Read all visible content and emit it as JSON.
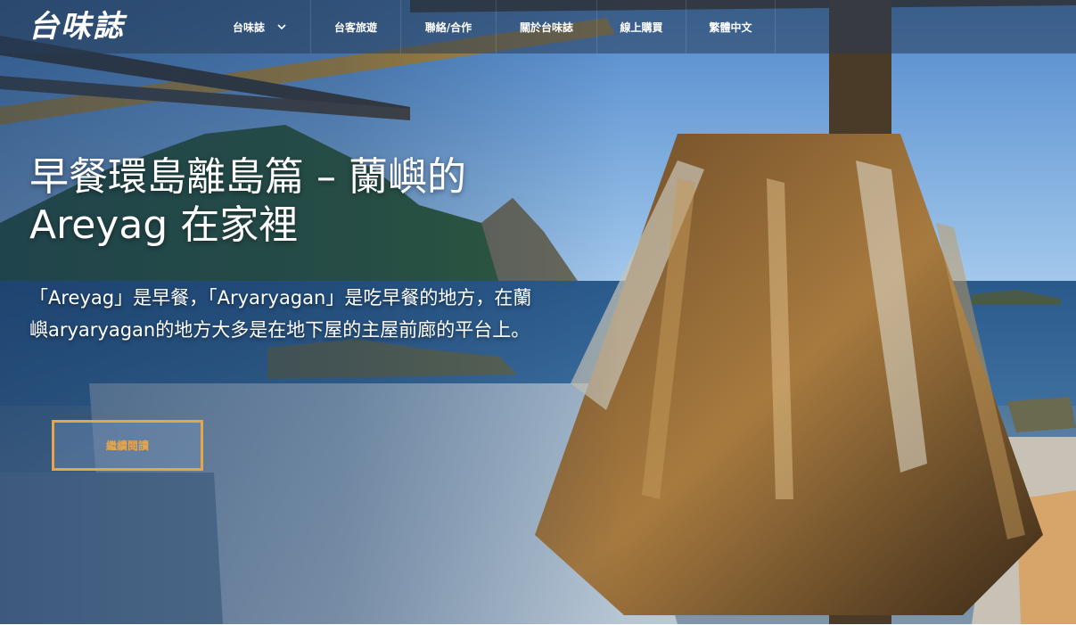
{
  "site": {
    "logo_text": "台味誌"
  },
  "nav": {
    "items": [
      {
        "label": "台味誌",
        "has_dropdown": true
      },
      {
        "label": "台客旅遊",
        "has_dropdown": false
      },
      {
        "label": "聯絡/合作",
        "has_dropdown": false
      },
      {
        "label": "關於台味誌",
        "has_dropdown": false
      },
      {
        "label": "線上購買",
        "has_dropdown": false
      },
      {
        "label": "繁體中文",
        "has_dropdown": false
      }
    ],
    "dropdown_icon": "chevron-down-icon"
  },
  "hero": {
    "title_line1": "早餐環島離島篇 – 蘭嶼的",
    "title_line2": "Areyag 在家裡",
    "excerpt": "「Areyag」是早餐，「Aryaryagan」是吃早餐的地方，在蘭嶼aryaryagan的地方大多是在地下屋的主屋前廊的平台上。",
    "button_label": "繼續閱讀",
    "accent_color": "#e6a54a"
  }
}
